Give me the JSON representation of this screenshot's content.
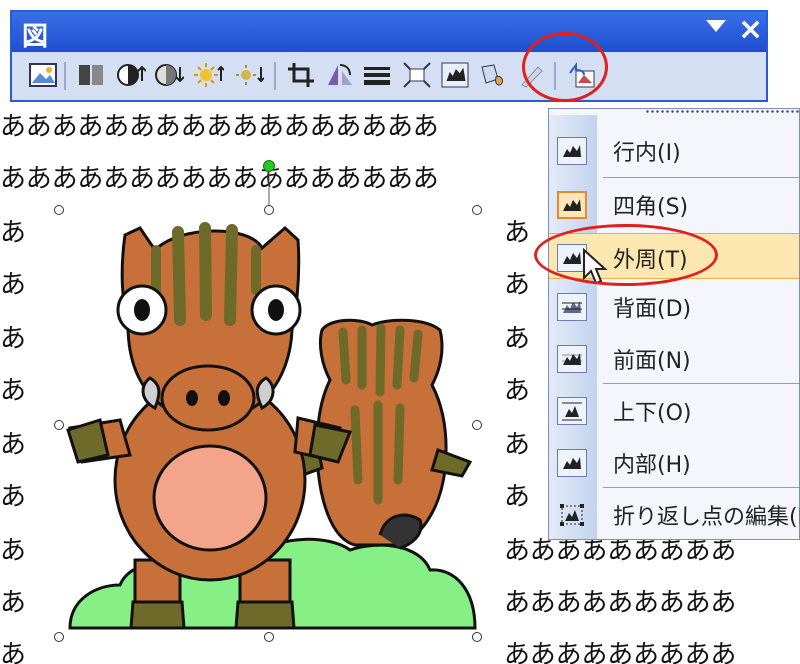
{
  "background": {
    "line_text_long": "あああああああああああああああああ",
    "line_text_short": "あ",
    "line_text_right": "ああ",
    "line_text_right_long": "あああああああああ"
  },
  "toolbar": {
    "title": "図",
    "close_symbol": "×",
    "buttons": [
      "insert-picture",
      "color",
      "more-contrast",
      "less-contrast",
      "more-brightness",
      "less-brightness",
      "crop",
      "rotate-left",
      "line-style",
      "compress-pictures",
      "text-wrapping",
      "format-picture",
      "set-transparent-color",
      "reset-picture"
    ]
  },
  "menu": {
    "items": [
      {
        "label": "行内(I)",
        "icon": "inline-wrap-icon"
      },
      {
        "label": "四角(S)",
        "icon": "square-wrap-icon"
      },
      {
        "label": "外周(T)",
        "icon": "tight-wrap-icon"
      },
      {
        "label": "背面(D)",
        "icon": "behind-text-icon"
      },
      {
        "label": "前面(N)",
        "icon": "in-front-of-text-icon"
      },
      {
        "label": "上下(O)",
        "icon": "top-bottom-wrap-icon"
      },
      {
        "label": "内部(H)",
        "icon": "through-wrap-icon"
      },
      {
        "label": "折り返し点の編集(E)",
        "icon": "edit-wrap-points-icon"
      }
    ],
    "checked_index": 1,
    "highlighted_index": 2
  },
  "colors": {
    "titlebar": "#1f4fd0",
    "highlight_ring": "#e0201c",
    "boar_body": "#c8703a",
    "stripes": "#6e6a2a",
    "grass": "#86ef86",
    "belly": "#f4a48a"
  }
}
